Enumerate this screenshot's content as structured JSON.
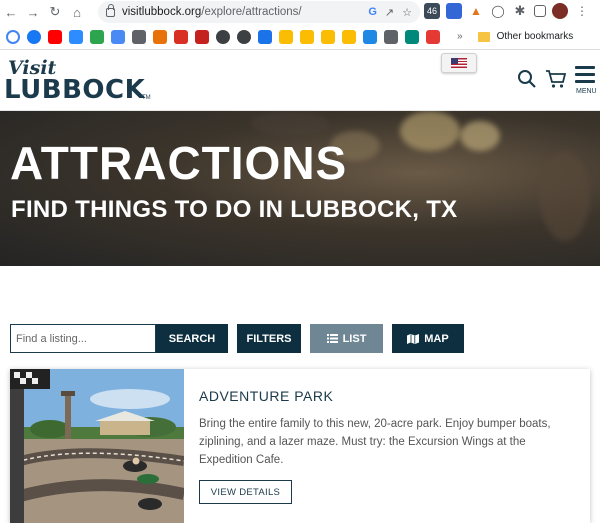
{
  "browser": {
    "url_domain": "visitlubbock.org",
    "url_path": "/explore/attractions/",
    "bookmarks_more": "»",
    "other_bookmarks": "Other bookmarks"
  },
  "header": {
    "logo_visit": "Visit",
    "logo_main": "LUBBOCK",
    "menu_label": "MENU"
  },
  "hero": {
    "title": "ATTRACTIONS",
    "subtitle": "FIND THINGS TO DO IN LUBBOCK, TX"
  },
  "search": {
    "placeholder": "Find a listing...",
    "search_label": "SEARCH",
    "filters_label": "FILTERS",
    "list_label": "LIST",
    "map_label": "MAP"
  },
  "listing": {
    "title": "ADVENTURE PARK",
    "description": "Bring the entire family to this new, 20-acre park. Enjoy bumper boats, ziplining, and a lazer maze. Must try: the Excursion Wings at the Expedition Cafe.",
    "details_label": "VIEW DETAILS"
  },
  "colors": {
    "brand_navy": "#0d2f3f",
    "logo_navy": "#1b3a4b",
    "list_active": "#6f8794"
  }
}
